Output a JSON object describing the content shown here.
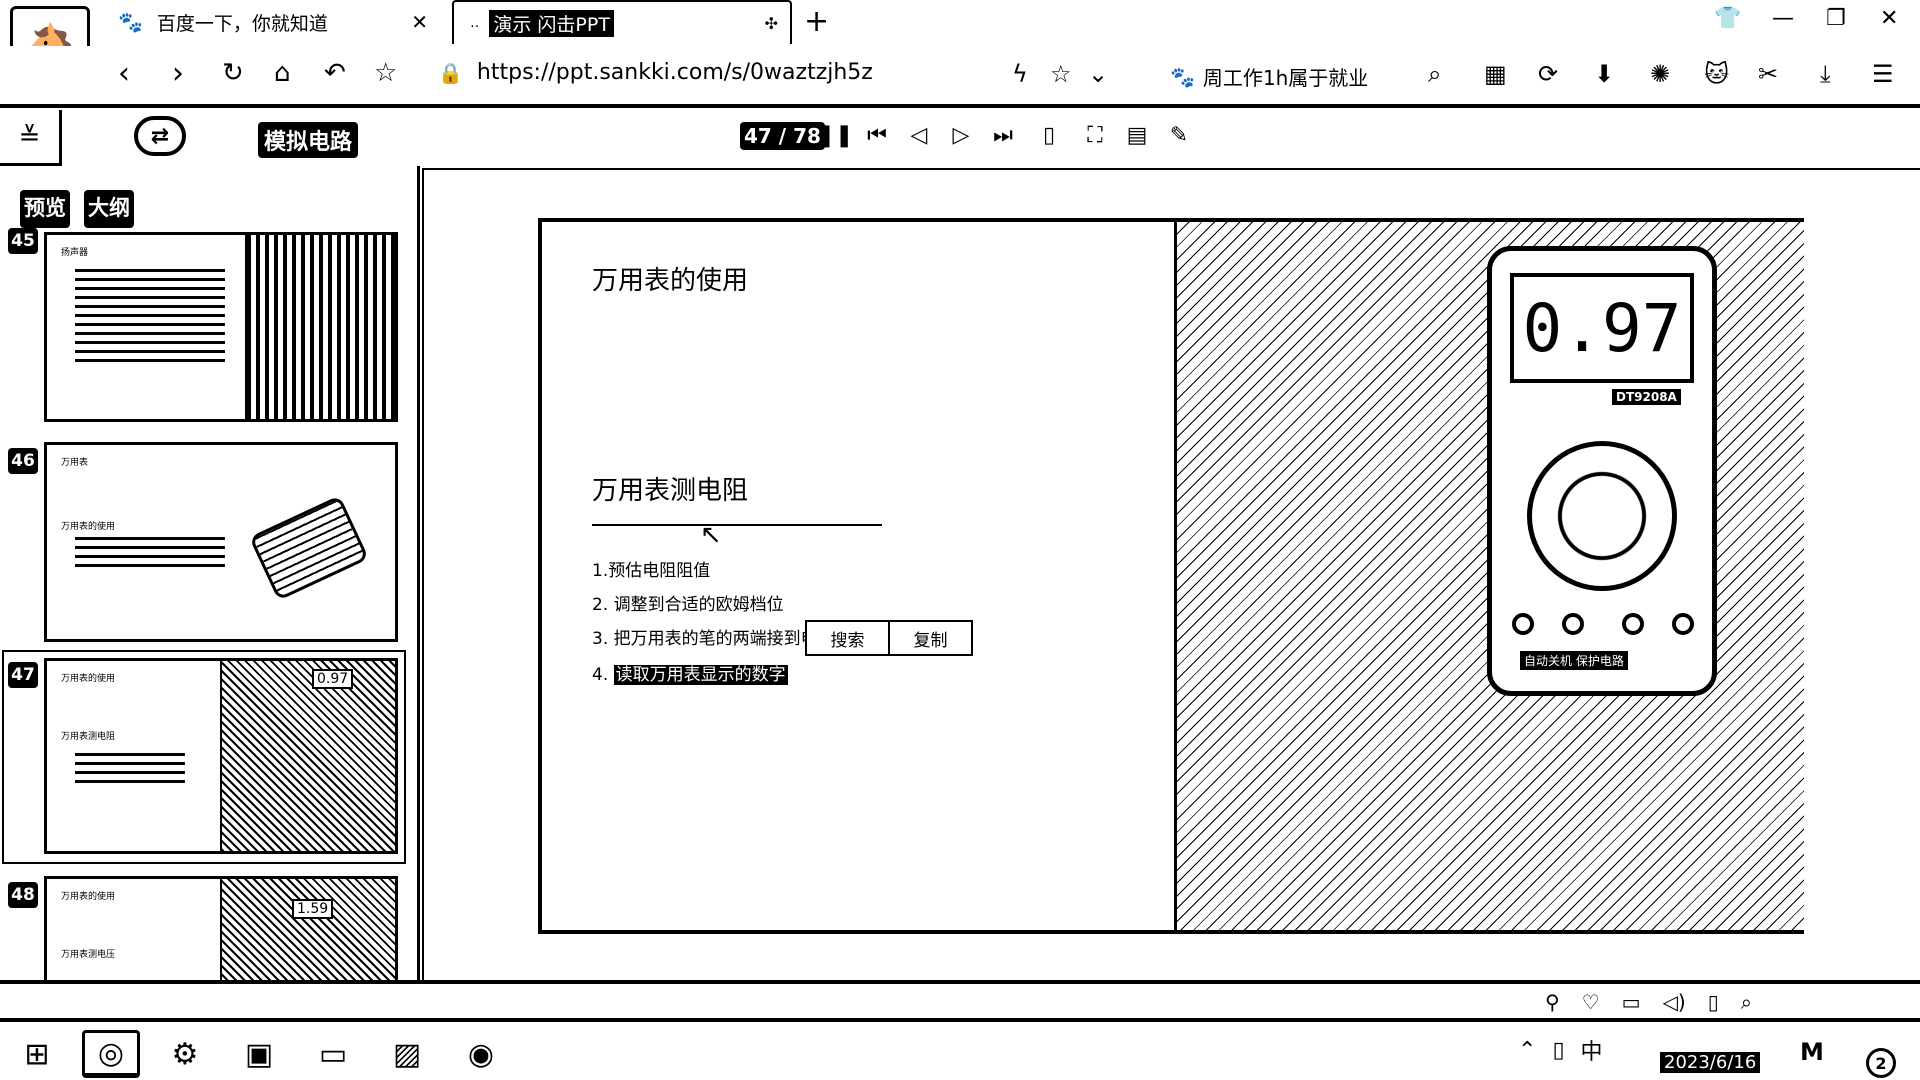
{
  "browser": {
    "tabs": [
      {
        "title": "百度一下，你就知道",
        "icon": "paw-icon"
      },
      {
        "title": "演示  闪击PPT",
        "icon": "dots-icon"
      }
    ],
    "url": "https://ppt.sankki.com/s/0waztzjh5z",
    "bookmark_text": "周工作1h属于就业"
  },
  "app": {
    "doc_title": "模拟电路",
    "page_indicator": "47 / 78",
    "sidebar_tabs": [
      "预览",
      "大纲"
    ]
  },
  "thumbnails": [
    {
      "num": "45",
      "title": "扬声器"
    },
    {
      "num": "46",
      "title": "万用表",
      "sub": "万用表的使用"
    },
    {
      "num": "47",
      "title": "万用表的使用",
      "sub": "万用表测电阻",
      "reading": "0.97"
    },
    {
      "num": "48",
      "title": "万用表的使用",
      "sub": "万用表测电压",
      "reading": "1.59"
    }
  ],
  "slide": {
    "title": "万用表的使用",
    "subtitle": "万用表测电阻",
    "steps": [
      "1.预估电阻阻值",
      "2. 调整到合适的欧姆档位",
      "3. 把万用表的笔的两端接到电",
      "4. "
    ],
    "highlighted": "读取万用表显示的数字",
    "meter_reading": "0.97",
    "meter_model": "DT9208A",
    "meter_caption": "自动关机 保护电路"
  },
  "context_menu": [
    "搜索",
    "复制"
  ],
  "taskbar": {
    "date": "2023/6/16",
    "ime": "中",
    "notifications": "2"
  }
}
